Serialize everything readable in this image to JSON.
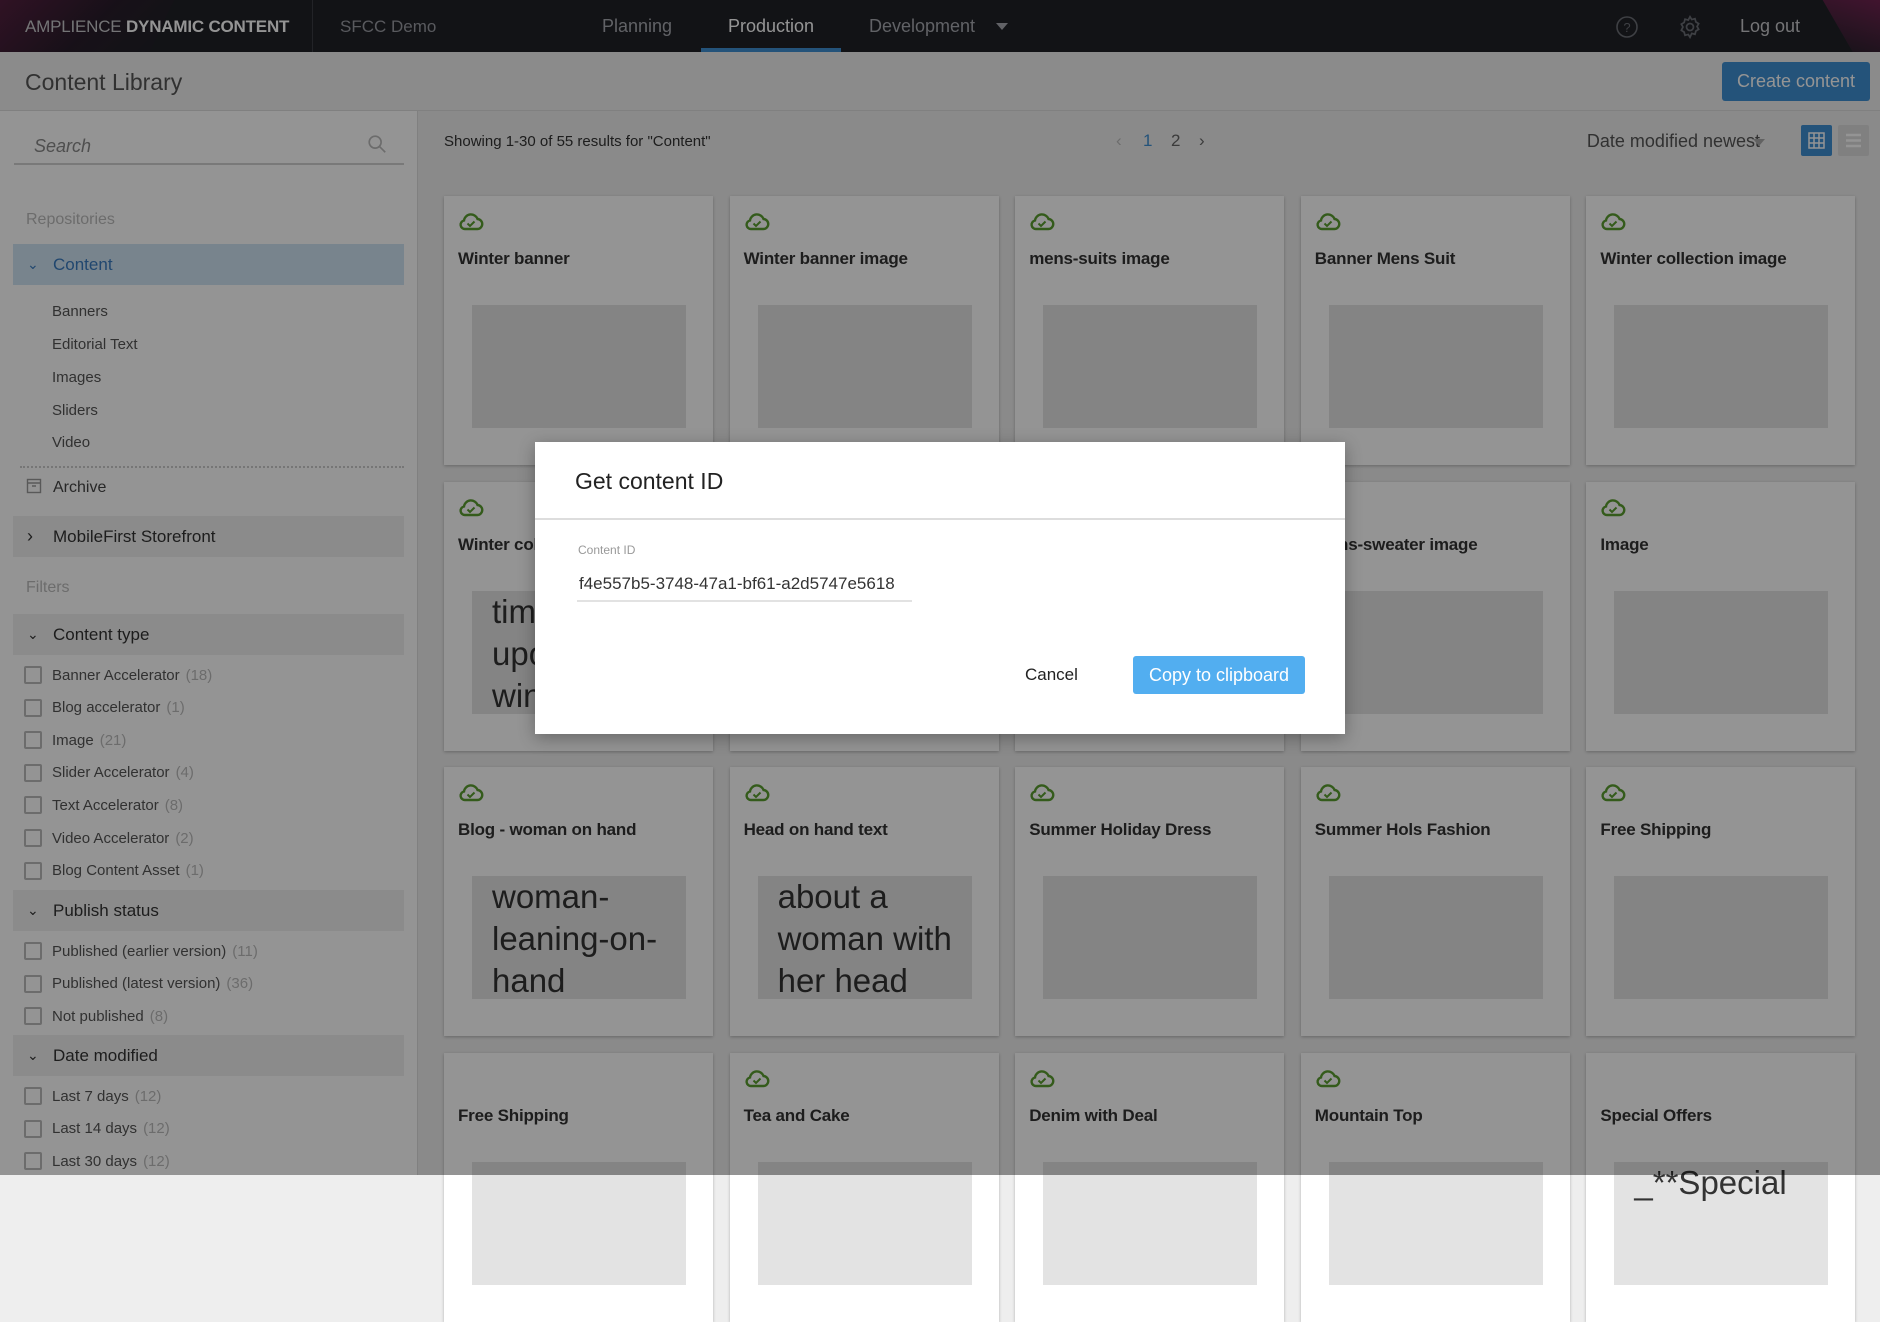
{
  "topbar": {
    "logo_light": "AMPLIENCE ",
    "logo_bold": "DYNAMIC CONTENT",
    "hub": "SFCC Demo",
    "tabs": [
      {
        "label": "Planning",
        "active": false
      },
      {
        "label": "Production",
        "active": true
      },
      {
        "label": "Development",
        "active": false
      }
    ],
    "help_icon": "question-circle-icon",
    "settings_icon": "gear-icon",
    "logout": "Log out"
  },
  "header": {
    "title": "Content Library",
    "create_button": "Create content"
  },
  "sidebar": {
    "search_placeholder": "Search",
    "repositories_label": "Repositories",
    "repositories": [
      {
        "label": "Content",
        "expanded": true,
        "children": [
          "Banners",
          "Editorial Text",
          "Images",
          "Sliders",
          "Video"
        ]
      },
      {
        "label": "MobileFirst Storefront",
        "expanded": false
      }
    ],
    "archive": "Archive",
    "filters_label": "Filters",
    "filter_groups": [
      {
        "label": "Content type",
        "items": [
          {
            "label": "Banner Accelerator",
            "count": "(18)"
          },
          {
            "label": "Blog accelerator",
            "count": "(1)"
          },
          {
            "label": "Image",
            "count": "(21)"
          },
          {
            "label": "Slider Accelerator",
            "count": "(4)"
          },
          {
            "label": "Text Accelerator",
            "count": "(8)"
          },
          {
            "label": "Video Accelerator",
            "count": "(2)"
          },
          {
            "label": "Blog Content Asset",
            "count": "(1)"
          }
        ]
      },
      {
        "label": "Publish status",
        "items": [
          {
            "label": "Published (earlier version)",
            "count": "(11)"
          },
          {
            "label": "Published (latest version)",
            "count": "(36)"
          },
          {
            "label": "Not published",
            "count": "(8)"
          }
        ]
      },
      {
        "label": "Date modified",
        "items": [
          {
            "label": "Last 7 days",
            "count": "(12)"
          },
          {
            "label": "Last 14 days",
            "count": "(12)"
          },
          {
            "label": "Last 30 days",
            "count": "(12)"
          }
        ]
      }
    ]
  },
  "toolbar": {
    "results": "Showing 1-30 of 55 results for \"Content\"",
    "pages": [
      "1",
      "2"
    ],
    "current_page": "1",
    "sort": "Date modified newest",
    "view": "grid"
  },
  "cards": [
    {
      "title": "Winter banner",
      "published": true,
      "thumbnail": "winter"
    },
    {
      "title": "Winter banner image",
      "published": true,
      "thumbnail": "winter"
    },
    {
      "title": "mens-suits image",
      "published": true,
      "thumbnail": "suit"
    },
    {
      "title": "Banner Mens Suit",
      "published": true,
      "thumbnail": "suit"
    },
    {
      "title": "Winter collection image",
      "published": true,
      "thumbnail": "scarf"
    },
    {
      "title": "Winter col",
      "published": true,
      "text": [
        "tim",
        "upo",
        "win"
      ]
    },
    {
      "title": "",
      "published": false
    },
    {
      "title": "",
      "published": false
    },
    {
      "title": "Mens-sweater image",
      "published": true,
      "thumbnail": "sweater"
    },
    {
      "title": "Image",
      "published": true,
      "thumbnail": "face"
    },
    {
      "title": "Blog - woman on hand",
      "published": true,
      "text": [
        "woman-",
        "leaning-on-",
        "hand"
      ]
    },
    {
      "title": "Head on hand text",
      "published": true,
      "text": [
        "about a",
        "woman with",
        "her head"
      ]
    },
    {
      "title": "Summer Holiday Dress",
      "published": true,
      "thumbnail": "dress"
    },
    {
      "title": "Summer Hols Fashion",
      "published": true,
      "thumbnail": "dress"
    },
    {
      "title": "Free Shipping",
      "published": true,
      "thumbnail": "truck"
    },
    {
      "title": "Free Shipping",
      "published": false,
      "text": []
    },
    {
      "title": "Tea and Cake",
      "published": true,
      "thumbnail": "fire"
    },
    {
      "title": "Denim with Deal",
      "published": true,
      "thumbnail": "denim"
    },
    {
      "title": "Mountain Top",
      "published": true,
      "thumbnail": "mountain"
    },
    {
      "title": "Special Offers",
      "published": false,
      "text": [
        "_**Special"
      ]
    }
  ],
  "colors": {
    "accent": "#3f8fd2",
    "published": "#5a9e2f",
    "copy_button": "#52aef0"
  },
  "modal": {
    "title": "Get content ID",
    "field_label": "Content ID",
    "field_value": "f4e557b5-3748-47a1-bf61-a2d5747e5618",
    "cancel": "Cancel",
    "copy": "Copy to clipboard"
  }
}
